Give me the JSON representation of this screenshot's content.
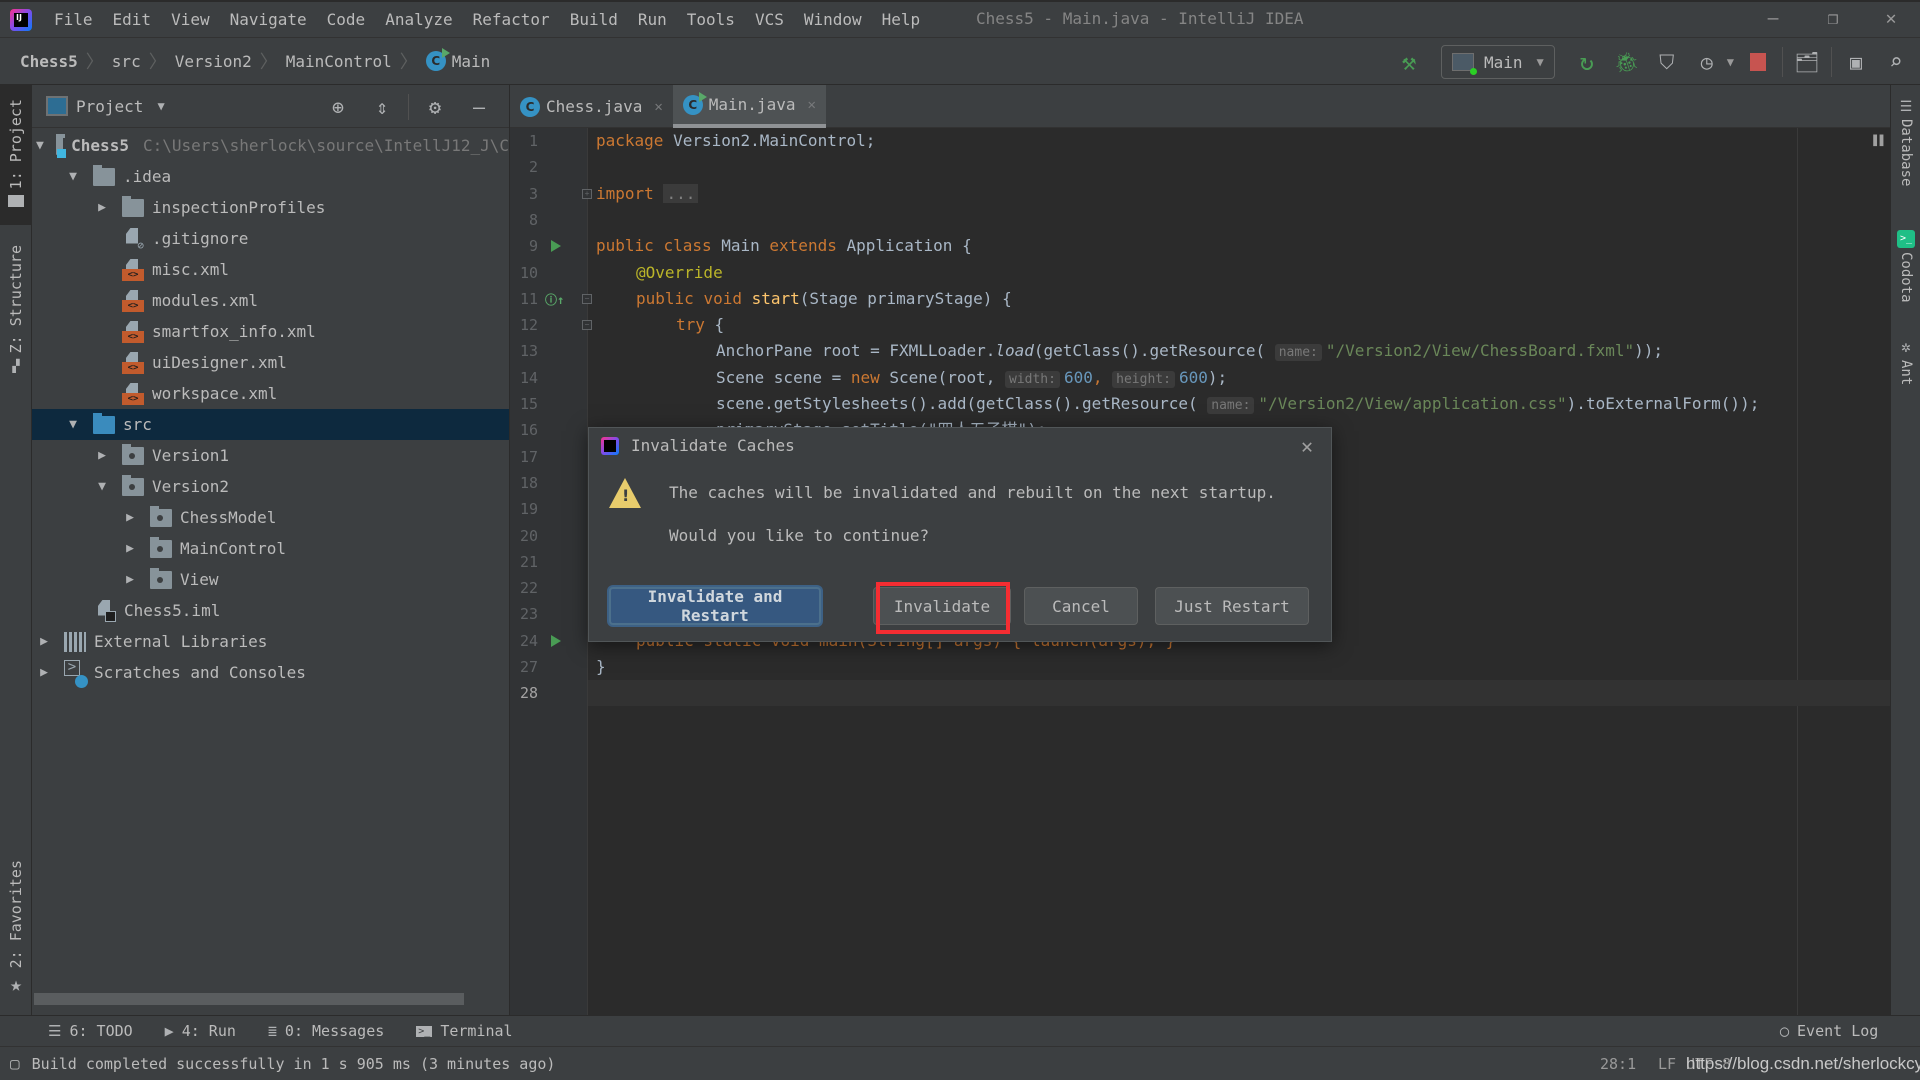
{
  "window": {
    "title": "Chess5 - Main.java - IntelliJ IDEA",
    "menu": [
      {
        "label": "File",
        "mnemonic": "F"
      },
      {
        "label": "Edit",
        "mnemonic": "E"
      },
      {
        "label": "View",
        "mnemonic": "V"
      },
      {
        "label": "Navigate",
        "mnemonic": "N"
      },
      {
        "label": "Code",
        "mnemonic": "C"
      },
      {
        "label": "Analyze",
        "mnemonic": "z"
      },
      {
        "label": "Refactor",
        "mnemonic": "R"
      },
      {
        "label": "Build",
        "mnemonic": "B"
      },
      {
        "label": "Run",
        "mnemonic": "u"
      },
      {
        "label": "Tools",
        "mnemonic": "T"
      },
      {
        "label": "VCS",
        "mnemonic": "S"
      },
      {
        "label": "Window",
        "mnemonic": "W"
      },
      {
        "label": "Help",
        "mnemonic": "H"
      }
    ]
  },
  "breadcrumb": [
    "Chess5",
    "src",
    "Version2",
    "MainControl",
    "Main"
  ],
  "toolbar": {
    "run_config": "Main",
    "icons": [
      "build-hammer-icon",
      "rerun-icon",
      "debug-icon",
      "coverage-icon",
      "profile-icon",
      "stop-icon",
      "project-structure-icon",
      "run-anything-icon",
      "search-icon"
    ]
  },
  "left_strip": {
    "project_tab": "1: Project",
    "structure_tab": "Z: Structure",
    "favorites_tab": "2: Favorites"
  },
  "right_strip": {
    "tabs": [
      "Database",
      "Codota",
      "Ant"
    ]
  },
  "project_panel": {
    "title": "Project",
    "tree": [
      {
        "label": "Chess5",
        "detail": "C:\\Users\\sherlock\\source\\IntellJ12_J\\C",
        "type": "module",
        "depth": 0,
        "expanded": true
      },
      {
        "label": ".idea",
        "type": "folder",
        "depth": 1,
        "expanded": true
      },
      {
        "label": "inspectionProfiles",
        "type": "folder",
        "depth": 2,
        "expanded": false
      },
      {
        "label": ".gitignore",
        "type": "ignore",
        "depth": 2
      },
      {
        "label": "misc.xml",
        "type": "xml",
        "depth": 2
      },
      {
        "label": "modules.xml",
        "type": "xml",
        "depth": 2
      },
      {
        "label": "smartfox_info.xml",
        "type": "xml",
        "depth": 2
      },
      {
        "label": "uiDesigner.xml",
        "type": "xml",
        "depth": 2
      },
      {
        "label": "workspace.xml",
        "type": "xml",
        "depth": 2
      },
      {
        "label": "src",
        "type": "src",
        "depth": 1,
        "expanded": true,
        "selected": true
      },
      {
        "label": "Version1",
        "type": "package",
        "depth": 2,
        "expanded": false
      },
      {
        "label": "Version2",
        "type": "package",
        "depth": 2,
        "expanded": true
      },
      {
        "label": "ChessModel",
        "type": "package",
        "depth": 3,
        "expanded": false
      },
      {
        "label": "MainControl",
        "type": "package",
        "depth": 3,
        "expanded": false
      },
      {
        "label": "View",
        "type": "package",
        "depth": 3,
        "expanded": false
      },
      {
        "label": "Chess5.iml",
        "type": "iml",
        "depth": 1
      },
      {
        "label": "External Libraries",
        "type": "libs",
        "depth": 0,
        "expanded": false
      },
      {
        "label": "Scratches and Consoles",
        "type": "scratch",
        "depth": 0,
        "expanded": false
      }
    ]
  },
  "editor": {
    "tabs": [
      {
        "label": "Chess.java",
        "active": false
      },
      {
        "label": "Main.java",
        "active": true
      }
    ],
    "line_numbers": [
      "1",
      "2",
      "3",
      "8",
      "9",
      "10",
      "11",
      "12",
      "13",
      "14",
      "15",
      "16",
      "17",
      "18",
      "19",
      "20",
      "21",
      "22",
      "23",
      "24",
      "27",
      "28"
    ],
    "code": {
      "l1_kw": "package",
      "l1_rest": " Version2.MainControl;",
      "l3_kw": "import",
      "l3_fold": "...",
      "l9_public": "public",
      "l9_class": "class",
      "l9_name": " Main ",
      "l9_extends": "extends",
      "l9_rest": " Application {",
      "l10_ann": "@Override",
      "l11_public": "public",
      "l11_void": "void",
      "l11_fn": "start",
      "l11_rest": "(Stage primaryStage) {",
      "l12_try": "try",
      "l12_rest": " {",
      "l13_a": "AnchorPane root = FXMLLoader.",
      "l13_load": "load",
      "l13_b": "(getClass().getResource(",
      "l13_hint": "name:",
      "l13_str": "\"/Version2/View/ChessBoard.fxml\"",
      "l13_c": "));",
      "l14_a": "Scene scene = ",
      "l14_new": "new",
      "l14_b": " Scene(root,",
      "l14_hint_w": "width:",
      "l14_w": "600",
      "l14_hint_h": "height:",
      "l14_h": "600",
      "l14_c": ");",
      "l15_a": "scene.getStylesheets().add(getClass().getResource(",
      "l15_hint": "name:",
      "l15_str": "\"/Version2/View/application.css\"",
      "l15_b": ").toExternalForm());",
      "l16_partial": "primaryStage.setTitle(\"四人五子棋\");",
      "l24_partial": "public static void main(String[] args) { launch(args); }",
      "l27": "}"
    }
  },
  "dialog": {
    "title": "Invalidate Caches",
    "message": "The caches will be invalidated and rebuilt on the next startup.",
    "question": "Would you like to continue?",
    "buttons": {
      "invalidate_restart": "Invalidate and Restart",
      "invalidate": "Invalidate",
      "cancel": "Cancel",
      "just_restart": "Just Restart"
    },
    "highlighted_button": "Invalidate"
  },
  "tool_windows": [
    {
      "label": "6: TODO",
      "icon": "todo-icon"
    },
    {
      "label": "4: Run",
      "icon": "run-icon"
    },
    {
      "label": "0: Messages",
      "icon": "messages-icon"
    },
    {
      "label": "Terminal",
      "icon": "terminal-icon"
    }
  ],
  "event_log": "Event Log",
  "status": {
    "message": "Build completed successfully in 1 s 905 ms (3 minutes ago)",
    "caret": "28:1",
    "line_sep": "LF",
    "encoding": "UTF-8",
    "watermark": "https://blog.csdn.net/sherlockcy"
  }
}
